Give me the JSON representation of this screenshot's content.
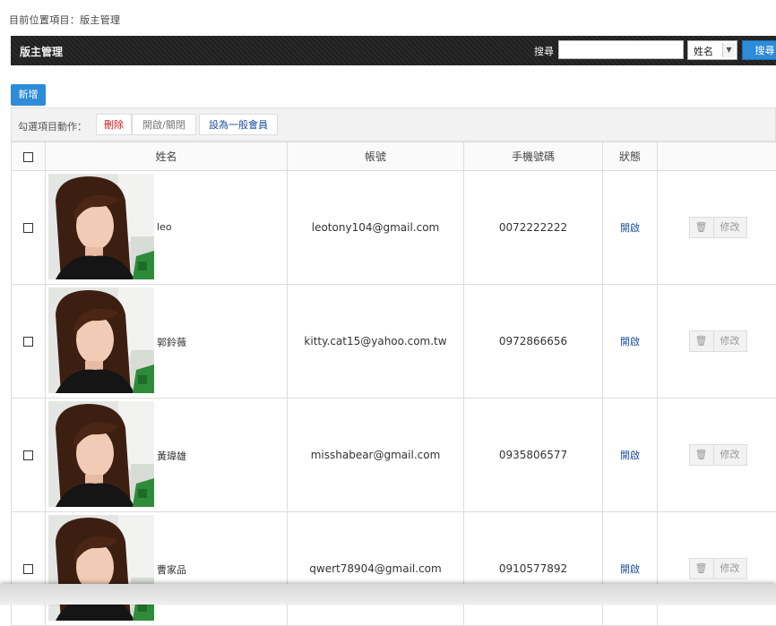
{
  "breadcrumb": "目前位置項目：版主管理",
  "header": {
    "title": "版主管理",
    "search_label": "搜尋",
    "search_value": "",
    "search_field": "姓名",
    "search_button": "搜尋"
  },
  "toolbar": {
    "add_button": "新增",
    "bulk_label": "勾選項目動作：",
    "delete": "刪除",
    "toggle": "開啟/關閉",
    "set_member": "設為一般會員"
  },
  "table": {
    "columns": [
      "姓名",
      "帳號",
      "手機號碼",
      "狀態"
    ],
    "edit_label": "修改",
    "rows": [
      {
        "name": "leo",
        "account": "leotony104@gmail.com",
        "phone": "0072222222",
        "status": "開啟"
      },
      {
        "name": "郭鈴薇",
        "account": "kitty.cat15@yahoo.com.tw",
        "phone": "0972866656",
        "status": "開啟"
      },
      {
        "name": "黃瑋雄",
        "account": "misshabear@gmail.com",
        "phone": "0935806577",
        "status": "開啟"
      },
      {
        "name": "曹家品",
        "account": "qwert78904@gmail.com",
        "phone": "0910577892",
        "status": "開啟"
      }
    ]
  },
  "colors": {
    "header_bg": "#222222",
    "primary_blue": "#2d8bd8",
    "delete_red": "#d31b1b",
    "link_blue": "#1e4fa0"
  }
}
